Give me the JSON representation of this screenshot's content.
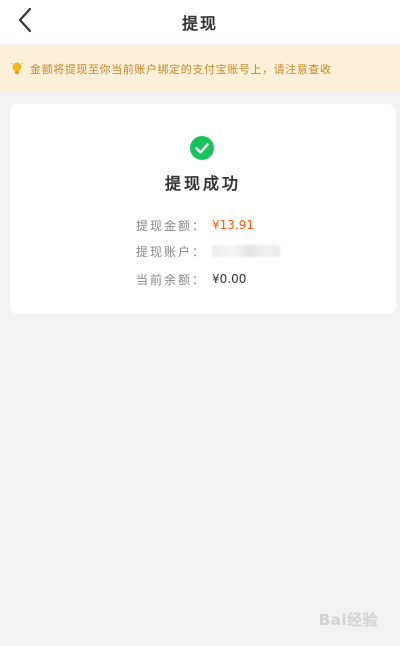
{
  "nav": {
    "title": "提现"
  },
  "notice": {
    "icon": "lightbulb-icon",
    "text": "金额将提现至你当前账户绑定的支付宝账号上，请注意查收",
    "color": "#c08a2e",
    "background": "#fdf0d8"
  },
  "result": {
    "icon": "check-circle-icon",
    "icon_color": "#1bc35e",
    "title": "提现成功",
    "amount_label": "提现金额：",
    "amount_value": "¥13.91",
    "amount_color": "#ff5a00",
    "account_label": "提现账户：",
    "balance_label": "当前余额：",
    "balance_value": "¥0.00"
  },
  "watermark": {
    "text": "Bai经验"
  }
}
